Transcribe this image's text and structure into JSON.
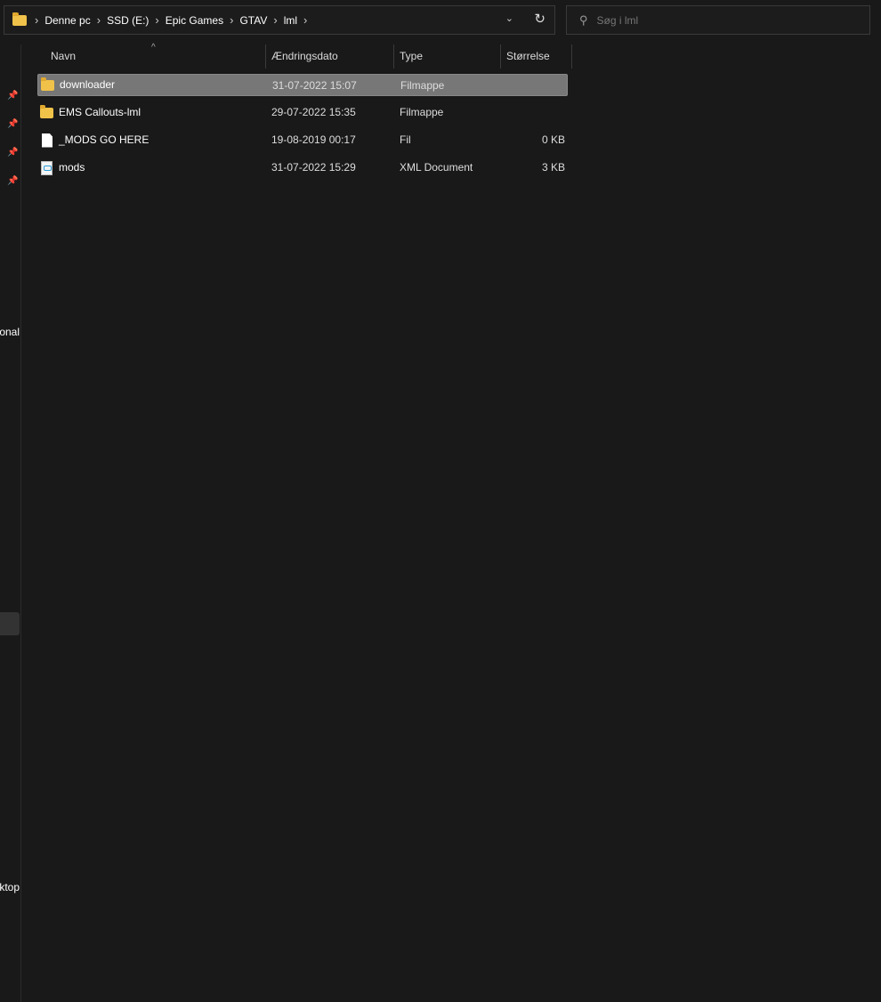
{
  "address_bar": {
    "breadcrumbs": [
      "Denne pc",
      "SSD (E:)",
      "Epic Games",
      "GTAV",
      "lml"
    ],
    "separator": "›",
    "dropdown_icon": "chevron-down-icon",
    "refresh_icon": "refresh-icon"
  },
  "search": {
    "placeholder": "Søg i lml"
  },
  "nav_pane": {
    "partial_labels": [
      "onal",
      "ktop"
    ]
  },
  "columns": [
    "Navn",
    "Ændringsdato",
    "Type",
    "Størrelse"
  ],
  "files": [
    {
      "name": "downloader",
      "date": "31-07-2022 15:07",
      "type": "Filmappe",
      "size": "",
      "icon": "folder-icon",
      "selected": true
    },
    {
      "name": "EMS Callouts-lml",
      "date": "29-07-2022 15:35",
      "type": "Filmappe",
      "size": "",
      "icon": "folder-icon",
      "selected": false
    },
    {
      "name": "_MODS GO HERE",
      "date": "19-08-2019 00:17",
      "type": "Fil",
      "size": "0 KB",
      "icon": "file-icon",
      "selected": false
    },
    {
      "name": "mods",
      "date": "31-07-2022 15:29",
      "type": "XML Document",
      "size": "3 KB",
      "icon": "xml-file-icon",
      "selected": false
    }
  ]
}
